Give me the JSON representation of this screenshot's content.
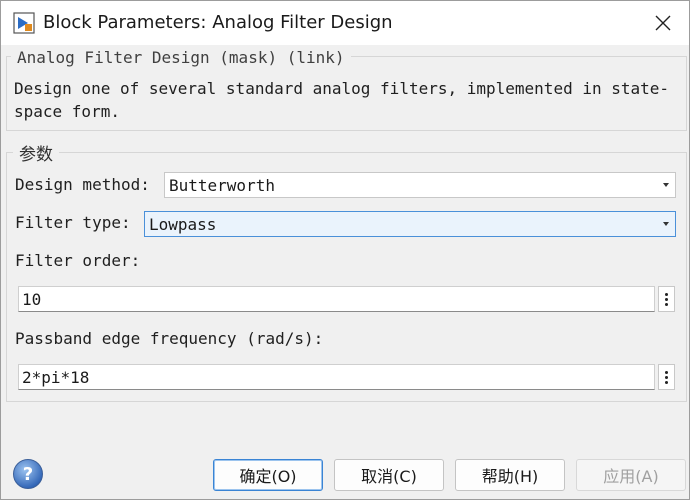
{
  "window": {
    "title": "Block Parameters: Analog Filter Design",
    "icon": "simulink-block-icon",
    "close_icon": "close-icon"
  },
  "description": {
    "legend": "Analog Filter Design (mask) (link)",
    "text": "Design one of several standard analog filters, implemented in state-space form."
  },
  "parameters": {
    "legend": "参数",
    "design_method": {
      "label": "Design method:",
      "value": "Butterworth"
    },
    "filter_type": {
      "label": "Filter type:",
      "value": "Lowpass"
    },
    "filter_order": {
      "label": "Filter order:",
      "value": "10"
    },
    "passband_edge": {
      "label": "Passband edge frequency (rad/s):",
      "value": "2*pi*18"
    }
  },
  "buttons": {
    "ok": "确定(O)",
    "cancel": "取消(C)",
    "help": "帮助(H)",
    "apply": "应用(A)"
  },
  "colors": {
    "accent": "#3a84d4",
    "help_icon": "#4a7fc8"
  }
}
